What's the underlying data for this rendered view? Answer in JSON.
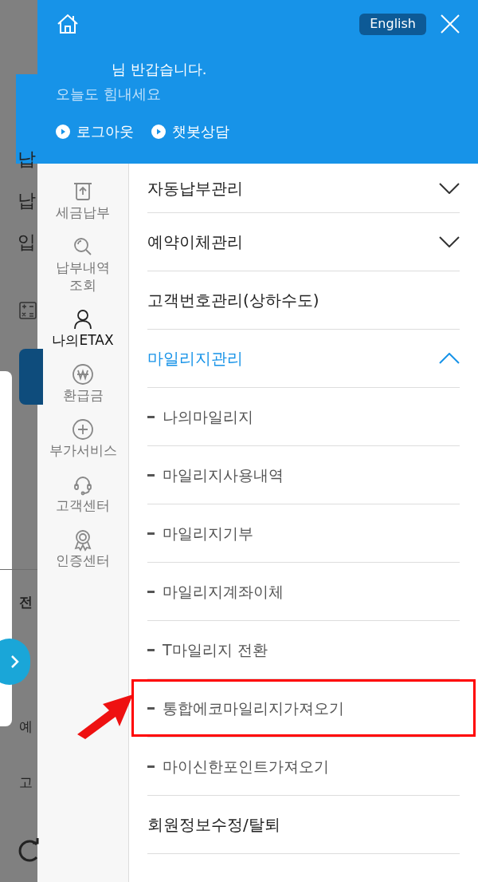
{
  "background_page": {
    "texts": [
      "납",
      "납",
      "입",
      "전",
      "예",
      "고"
    ]
  },
  "header": {
    "language_button": "English",
    "greeting": "님 반갑습니다.",
    "subtitle": "오늘도 힘내세요",
    "links": [
      "로그아웃",
      "챗봇상담"
    ]
  },
  "sidebar": {
    "items": [
      {
        "label": "세금납부",
        "kind": "receipt",
        "selected": false
      },
      {
        "label": "납부내역\n조회",
        "kind": "search",
        "selected": false
      },
      {
        "label": "나의ETAX",
        "kind": "person",
        "selected": true
      },
      {
        "label": "환급금",
        "kind": "won",
        "selected": false
      },
      {
        "label": "부가서비스",
        "kind": "plus",
        "selected": false
      },
      {
        "label": "고객센터",
        "kind": "headset",
        "selected": false
      },
      {
        "label": "인증센터",
        "kind": "badge",
        "selected": false
      }
    ]
  },
  "menu": {
    "items": [
      {
        "label": "자동납부관리",
        "expandable": true,
        "expanded": false
      },
      {
        "label": "예약이체관리",
        "expandable": true,
        "expanded": false
      },
      {
        "label": "고객번호관리(상하수도)",
        "expandable": false,
        "expanded": false
      },
      {
        "label": "마일리지관리",
        "expandable": true,
        "expanded": true,
        "children": [
          {
            "label": "나의마일리지",
            "highlighted": false
          },
          {
            "label": "마일리지사용내역",
            "highlighted": false
          },
          {
            "label": "마일리지기부",
            "highlighted": false
          },
          {
            "label": "마일리지계좌이체",
            "highlighted": false
          },
          {
            "label": "T마일리지 전환",
            "highlighted": false
          },
          {
            "label": "통합에코마일리지가져오기",
            "highlighted": true
          },
          {
            "label": "마이신한포인트가져오기",
            "highlighted": false
          }
        ]
      },
      {
        "label": "회원정보수정/탈퇴",
        "expandable": false,
        "expanded": false
      }
    ]
  }
}
